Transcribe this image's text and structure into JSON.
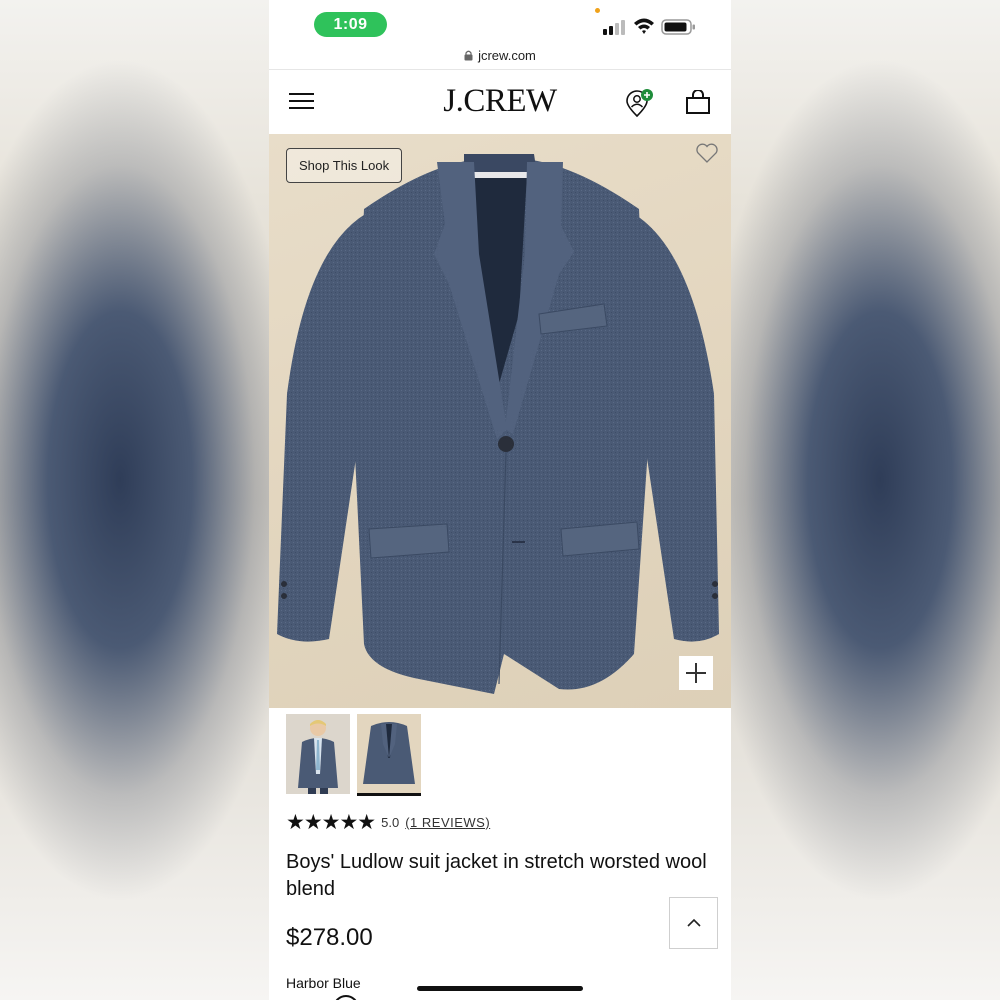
{
  "status_bar": {
    "time": "1:09",
    "icons": [
      "signal-icon",
      "wifi-icon",
      "battery-icon"
    ]
  },
  "browser": {
    "url": "jcrew.com"
  },
  "header": {
    "logo": "J.CREW",
    "icons": [
      "menu-icon",
      "account-icon",
      "shopping-bag-icon"
    ]
  },
  "hero": {
    "shop_look_label": "Shop This Look",
    "icons": [
      "heart-icon",
      "plus-icon"
    ]
  },
  "thumbnails": [
    {
      "name": "model-thumbnail",
      "selected": false
    },
    {
      "name": "jacket-thumbnail",
      "selected": true
    }
  ],
  "product": {
    "stars": "★★★★★",
    "rating": "5.0",
    "reviews_label": "(1 REVIEWS)",
    "title": "Boys' Ludlow suit jacket in stretch worsted wool blend",
    "price": "$278.00",
    "color_name": "Harbor Blue"
  },
  "colors": {
    "time_pill": "#2fc25b",
    "account_badge": "#1e8c3a",
    "jacket": "#4a5a75",
    "hero_bg": "#e5d9c3"
  }
}
